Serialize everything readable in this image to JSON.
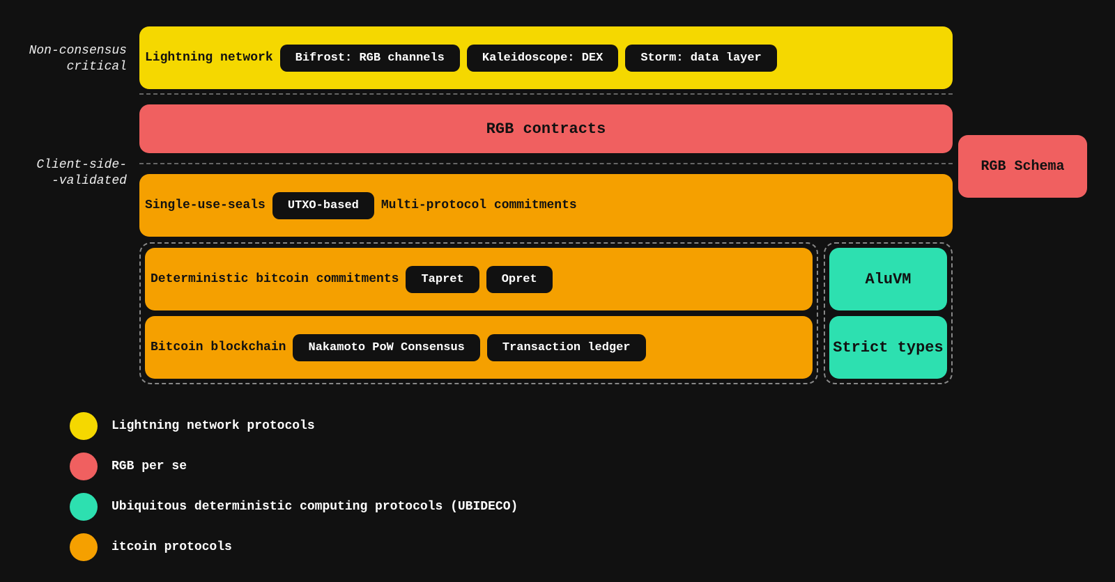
{
  "labels": {
    "non_consensus": "Non-consensus\ncritical",
    "client_side": "Client-side-\n-validated"
  },
  "rows": {
    "lightning": {
      "label": "Lightning network",
      "pills": [
        "Bifrost: RGB channels",
        "Kaleidoscope: DEX",
        "Storm: data layer"
      ]
    },
    "rgb_contracts": {
      "text": "RGB contracts"
    },
    "csv": {
      "label": "Single-use-seals",
      "inner_pill": "UTXO-based",
      "right_label": "Multi-protocol commitments",
      "far_right": "RGB Schema"
    },
    "dbc": {
      "label": "Deterministic bitcoin commitments",
      "pills": [
        "Tapret",
        "Opret"
      ],
      "right": "AluVM"
    },
    "blockchain": {
      "label": "Bitcoin blockchain",
      "pills": [
        "Nakamoto PoW Consensus",
        "Transaction ledger"
      ],
      "right": "Strict types"
    }
  },
  "legend": [
    {
      "color": "yellow",
      "text": "Lightning network protocols"
    },
    {
      "color": "salmon",
      "text": "RGB per se"
    },
    {
      "color": "teal",
      "text": "Ubiquitous deterministic computing protocols (UBIDECO)"
    },
    {
      "color": "orange",
      "text": " itcoin protocols"
    }
  ]
}
